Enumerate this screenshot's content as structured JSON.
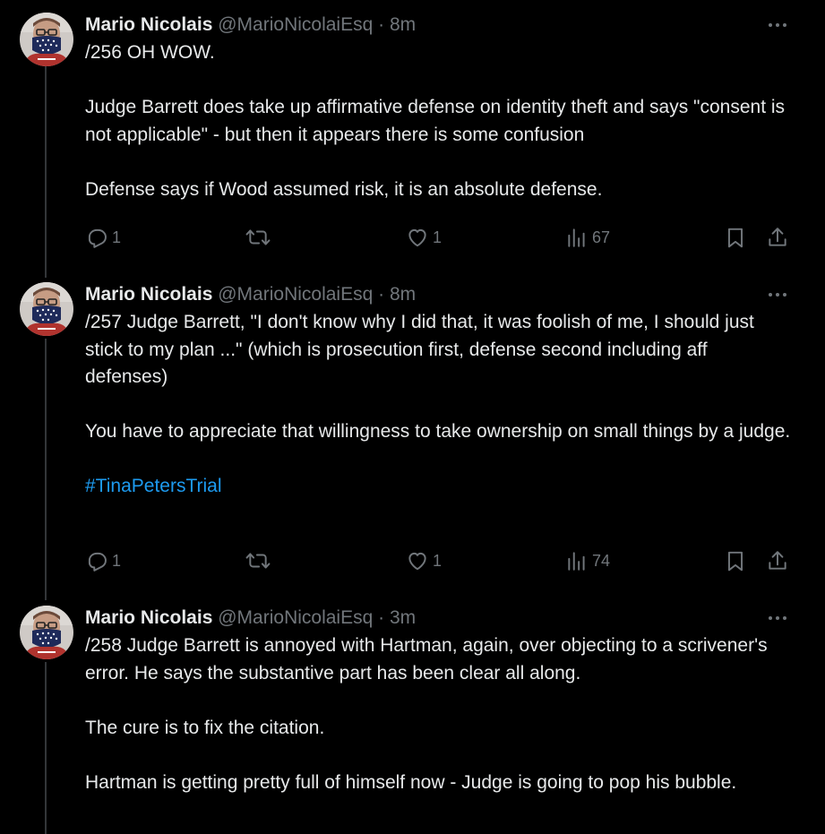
{
  "theme": {
    "background": "#000000",
    "text": "#e7e9ea",
    "muted": "#71767b",
    "link": "#1d9bf0",
    "thread_line": "#333639"
  },
  "tweets": [
    {
      "author": {
        "name": "Mario Nicolais",
        "handle": "@MarioNicolaiEsq"
      },
      "separator": "·",
      "time": "8m",
      "paragraphs": [
        "/256 OH WOW.",
        "Judge Barrett does take up affirmative defense on identity theft and says \"consent is not applicable\" - but then it appears there is some confusion",
        "Defense says if Wood assumed risk, it is an absolute defense."
      ],
      "hashtag": "",
      "replies": "1",
      "reposts": "",
      "likes": "1",
      "views": "67"
    },
    {
      "author": {
        "name": "Mario Nicolais",
        "handle": "@MarioNicolaiEsq"
      },
      "separator": "·",
      "time": "8m",
      "paragraphs": [
        "/257 Judge Barrett, \"I don't know why I did that, it was foolish of me, I should just stick to my plan ...\" (which is prosecution first, defense second including aff defenses)",
        "You have to appreciate that willingness to take ownership on small things by a judge."
      ],
      "hashtag": "#TinaPetersTrial",
      "replies": "1",
      "reposts": "",
      "likes": "1",
      "views": "74"
    },
    {
      "author": {
        "name": "Mario Nicolais",
        "handle": "@MarioNicolaiEsq"
      },
      "separator": "·",
      "time": "3m",
      "paragraphs": [
        "/258 Judge Barrett is annoyed with Hartman, again, over objecting to a scrivener's error. He says the substantive part has been clear all along.",
        "The cure is to fix the citation.",
        "Hartman is getting pretty full of himself now - Judge is going to pop his bubble."
      ],
      "hashtag": "",
      "replies": "",
      "reposts": "",
      "likes": "",
      "views": ""
    }
  ],
  "icons": {
    "more": "more-icon",
    "reply": "reply-icon",
    "repost": "repost-icon",
    "like": "heart-icon",
    "views": "views-icon",
    "bookmark": "bookmark-icon",
    "share": "share-icon"
  }
}
